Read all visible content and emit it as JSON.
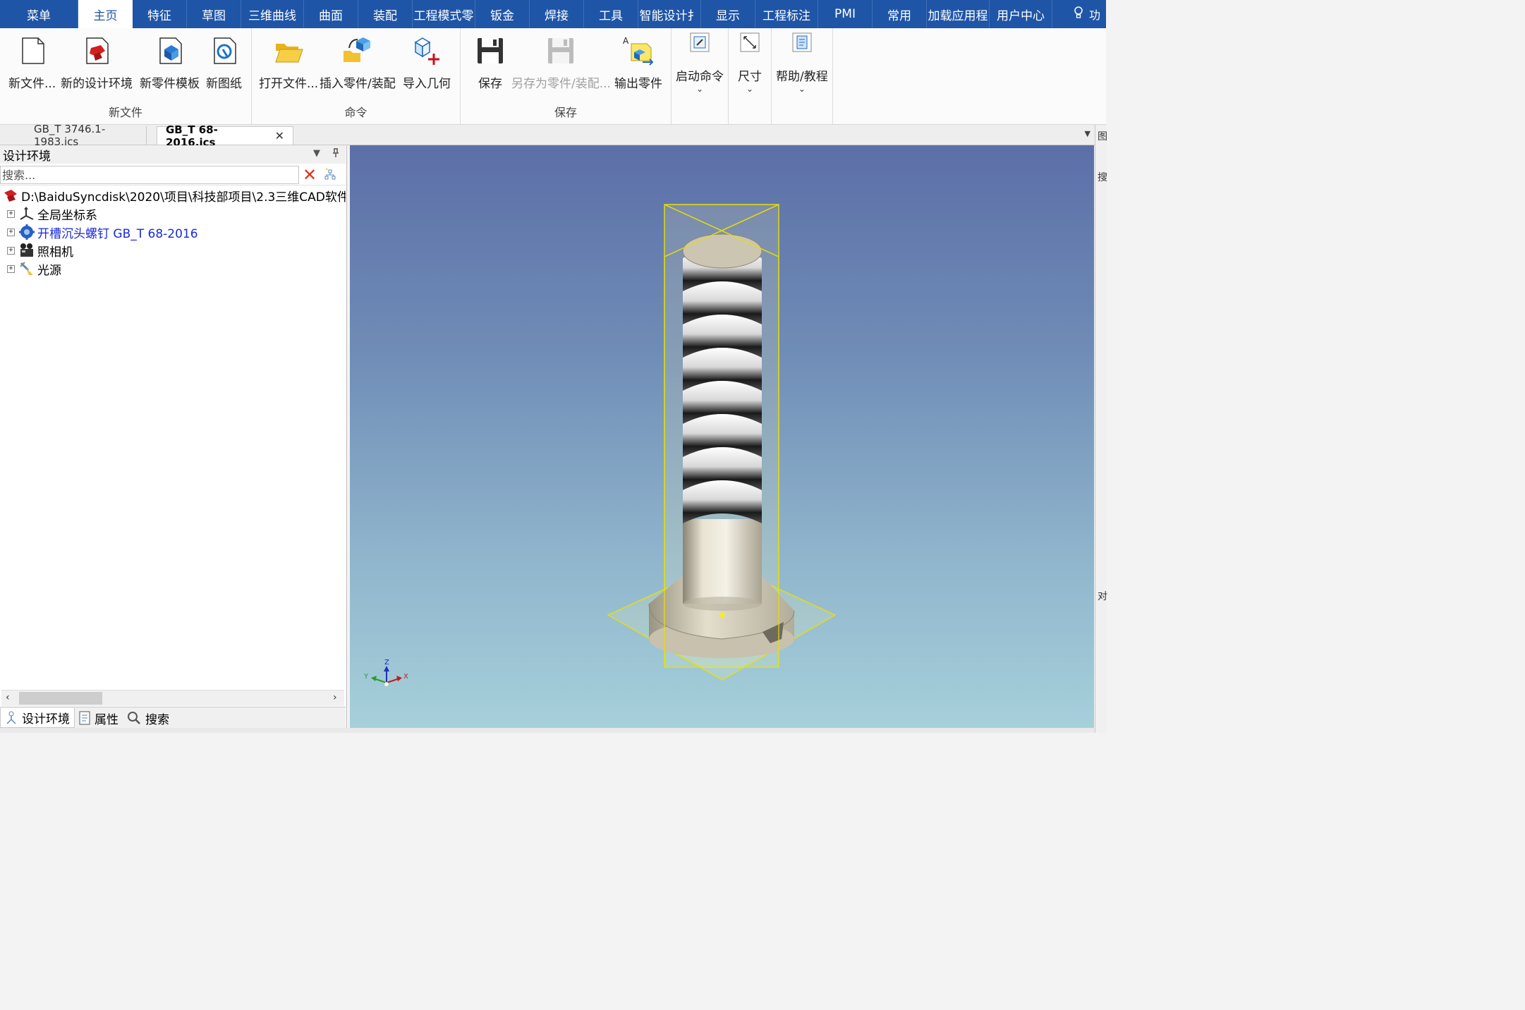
{
  "menubar": {
    "items": [
      {
        "label": "菜单"
      },
      {
        "label": "主页"
      },
      {
        "label": "特征"
      },
      {
        "label": "草图"
      },
      {
        "label": "三维曲线"
      },
      {
        "label": "曲面"
      },
      {
        "label": "装配"
      },
      {
        "label": "工程模式零"
      },
      {
        "label": "钣金"
      },
      {
        "label": "焊接"
      },
      {
        "label": "工具"
      },
      {
        "label": "智能设计扌"
      },
      {
        "label": "显示"
      },
      {
        "label": "工程标注"
      },
      {
        "label": "PMI"
      },
      {
        "label": "常用"
      },
      {
        "label": "加载应用程"
      },
      {
        "label": "用户中心"
      }
    ],
    "active": "主页",
    "help_label": "功"
  },
  "ribbon": {
    "groups": [
      {
        "label": "新文件"
      },
      {
        "label": "命令"
      },
      {
        "label": "保存"
      }
    ],
    "buttons": {
      "new_file": "新文件...",
      "new_design_env": "新的设计环境",
      "new_part_template": "新零件模板",
      "new_drawing": "新图纸",
      "open_file": "打开文件...",
      "insert_part": "插入零件/装配",
      "import_geometry": "导入几何",
      "save": "保存",
      "save_as_part": "另存为零件/装配...",
      "export_part": "输出零件",
      "launch_command": "启动命令",
      "dimension": "尺寸",
      "help_tutorial": "帮助/教程"
    }
  },
  "doc_tabs": [
    {
      "label": "GB_T 3746.1-1983.ics",
      "active": false
    },
    {
      "label": "GB_T 68-2016.ics",
      "active": true
    }
  ],
  "left_panel": {
    "title": "设计环境",
    "search_placeholder": "搜索...",
    "tree": [
      {
        "label": "D:\\BaiduSyncdisk\\2020\\项目\\科技部项目\\2.3三维CAD软件",
        "icon": "design-env-icon",
        "expander": false
      },
      {
        "label": "全局坐标系",
        "icon": "axis-icon",
        "expander": true
      },
      {
        "label": "开槽沉头螺钉 GB_T 68-2016",
        "icon": "part-icon",
        "expander": true,
        "color": "#1a2ad6"
      },
      {
        "label": "照相机",
        "icon": "camera-icon",
        "expander": true
      },
      {
        "label": "光源",
        "icon": "light-icon",
        "expander": true
      }
    ],
    "bottom_tabs": [
      {
        "label": "设计环境",
        "icon": "design-env-tab-icon",
        "active": true
      },
      {
        "label": "属性",
        "icon": "properties-icon",
        "active": false
      },
      {
        "label": "搜索",
        "icon": "search-icon",
        "active": false
      }
    ]
  },
  "viewport": {
    "triad_labels": {
      "z": "Z",
      "x": "X",
      "y": "Y"
    },
    "colors": {
      "bounding_box": "#e8e000",
      "anchor": "#ffee00"
    }
  },
  "right_edge": {
    "chars": [
      "图",
      "搜",
      "对"
    ]
  }
}
